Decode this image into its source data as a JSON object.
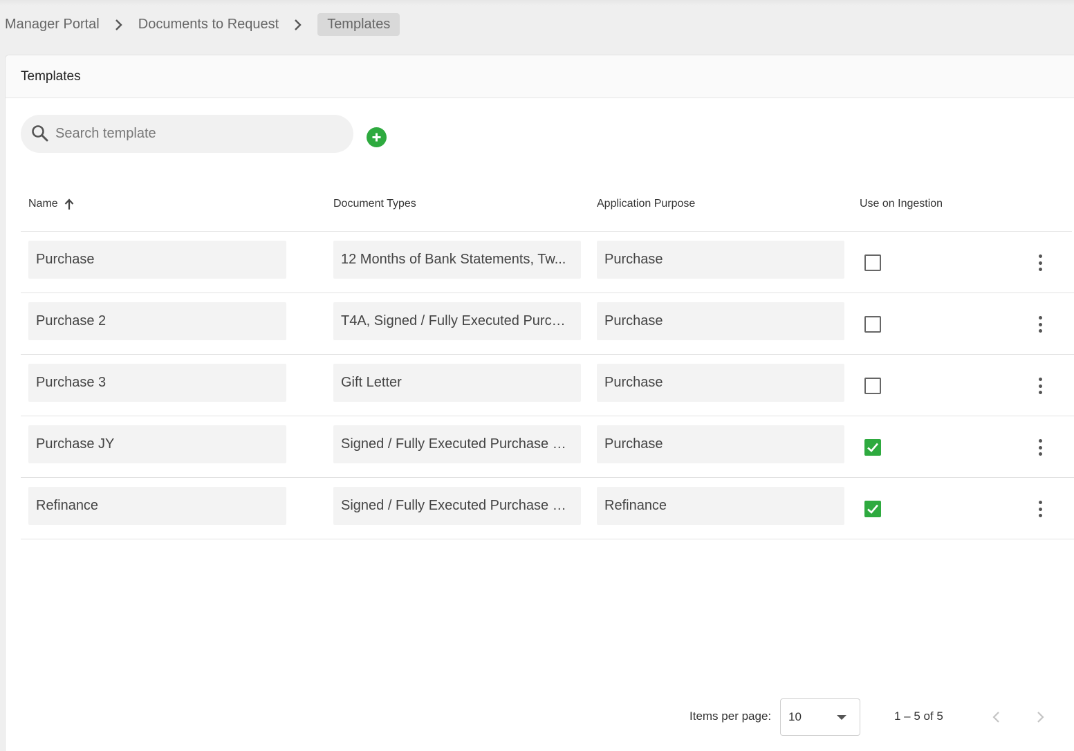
{
  "breadcrumb": {
    "items": [
      "Manager Portal",
      "Documents to Request"
    ],
    "current": "Templates"
  },
  "panel": {
    "title": "Templates"
  },
  "search": {
    "placeholder": "Search template",
    "value": ""
  },
  "table": {
    "columns": {
      "name": "Name",
      "document_types": "Document Types",
      "application_purpose": "Application Purpose",
      "use_on_ingestion": "Use on Ingestion"
    },
    "sort": {
      "column": "name",
      "direction": "asc",
      "icon": "arrow-up-icon"
    },
    "rows": [
      {
        "name": "Purchase",
        "document_types": "12 Months of Bank Statements, Tw...",
        "application_purpose": "Purchase",
        "use_on_ingestion": false
      },
      {
        "name": "Purchase 2",
        "document_types": "T4A, Signed / Fully Executed Purcha...",
        "application_purpose": "Purchase",
        "use_on_ingestion": false
      },
      {
        "name": "Purchase 3",
        "document_types": "Gift Letter",
        "application_purpose": "Purchase",
        "use_on_ingestion": false
      },
      {
        "name": "Purchase JY",
        "document_types": "Signed / Fully Executed Purchase O...",
        "application_purpose": "Purchase",
        "use_on_ingestion": true
      },
      {
        "name": "Refinance",
        "document_types": "Signed / Fully Executed Purchase O...",
        "application_purpose": "Refinance",
        "use_on_ingestion": true
      }
    ]
  },
  "paginator": {
    "items_per_page_label": "Items per page:",
    "items_per_page": "10",
    "range": "1 – 5 of 5"
  },
  "colors": {
    "accent": "#2eaa3f",
    "cell_bg": "#f3f3f3",
    "page_bg": "#efefef"
  }
}
